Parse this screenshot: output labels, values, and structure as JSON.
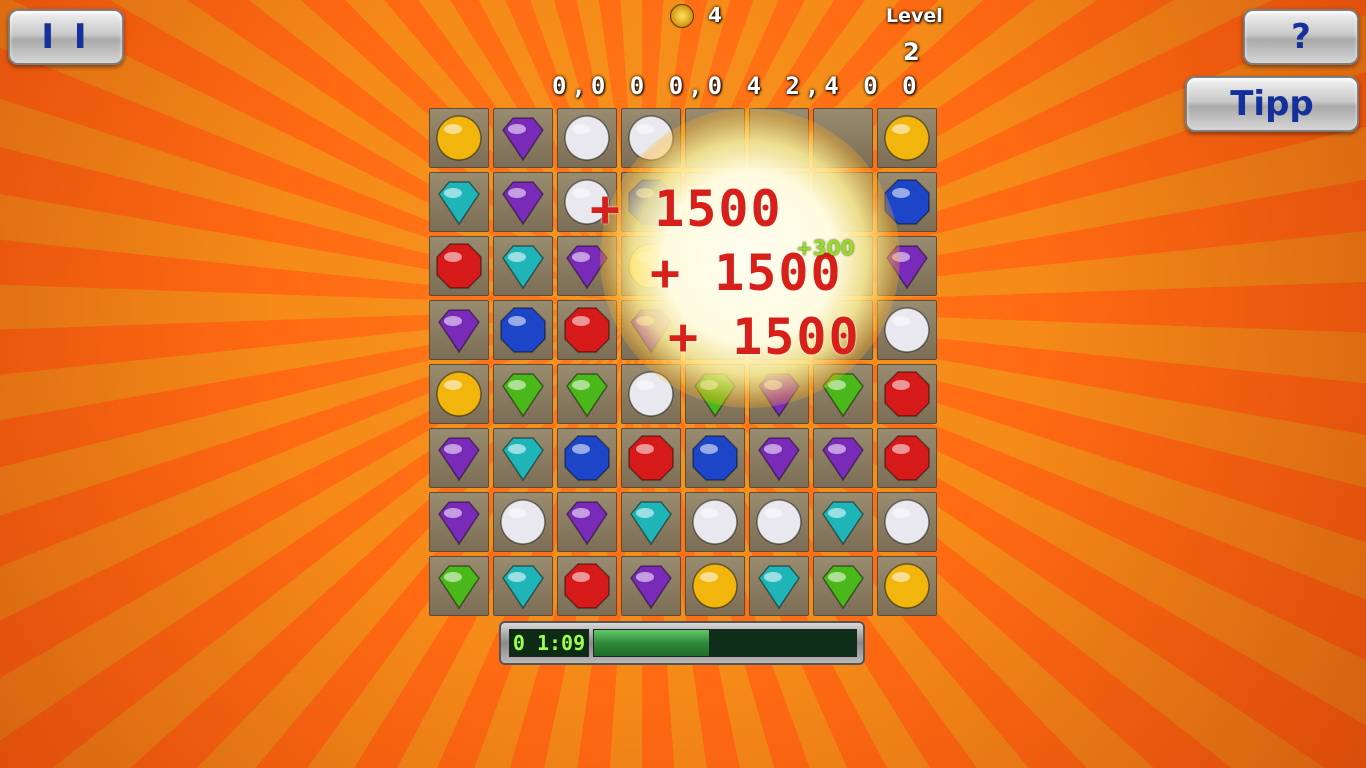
{
  "hud": {
    "pause_label": "I I",
    "help_label": "?",
    "hint_label": "Tipp",
    "lives_icon": "coin-icon",
    "lives_count": "4",
    "level_label": "Level",
    "level_value": "2",
    "score": "0,0 0 0,0 4 2,4 0 0"
  },
  "popups": {
    "bonus_1": "+ 1500",
    "bonus_2": "+ 1500",
    "bonus_3": "+ 1500",
    "small_bonus": "+300"
  },
  "timer": {
    "time": "0 1:09",
    "progress_fraction": 0.44
  },
  "colors": {
    "yellow": "#f2b50c",
    "purple": "#7a2ab8",
    "white": "#e8e8ee",
    "cyan": "#1fb5b8",
    "blue": "#1c45c8",
    "red": "#d61a1a",
    "green": "#4ab81a"
  },
  "board": [
    [
      "yellow",
      "purple",
      "white",
      "white",
      "empty",
      "empty",
      "empty",
      "yellow"
    ],
    [
      "cyan",
      "purple",
      "white",
      "blue",
      "empty",
      "empty",
      "empty",
      "blue"
    ],
    [
      "red",
      "cyan",
      "purple",
      "yellow",
      "empty",
      "empty",
      "empty",
      "purple"
    ],
    [
      "purple",
      "blue",
      "red",
      "purple",
      "empty",
      "empty",
      "empty",
      "white"
    ],
    [
      "yellow",
      "green",
      "green",
      "white",
      "green",
      "purple",
      "green",
      "red"
    ],
    [
      "purple",
      "cyan",
      "blue",
      "red",
      "blue",
      "purple",
      "purple",
      "red"
    ],
    [
      "purple",
      "white",
      "purple",
      "cyan",
      "white",
      "white",
      "cyan",
      "white"
    ],
    [
      "green",
      "cyan",
      "red",
      "purple",
      "yellow",
      "cyan",
      "green",
      "yellow"
    ]
  ]
}
